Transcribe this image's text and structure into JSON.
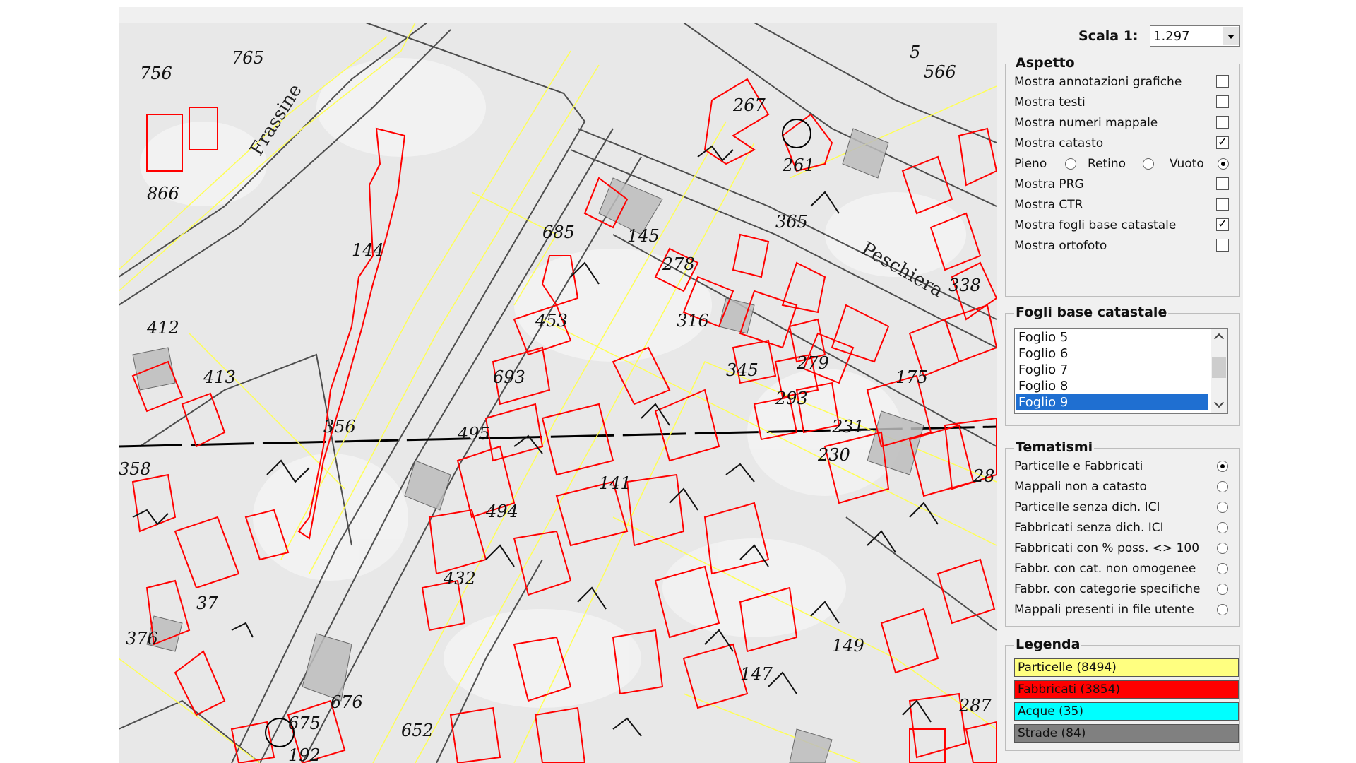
{
  "scale": {
    "label": "Scala 1:",
    "value": "1.297"
  },
  "aspetto": {
    "title": "Aspetto",
    "items": [
      {
        "label": "Mostra annotazioni grafiche",
        "checked": false
      },
      {
        "label": "Mostra testi",
        "checked": false
      },
      {
        "label": "Mostra numeri mappale",
        "checked": false
      },
      {
        "label": "Mostra catasto",
        "checked": true
      }
    ],
    "fill_mode": {
      "options": [
        {
          "label": "Pieno",
          "selected": false
        },
        {
          "label": "Retino",
          "selected": false
        },
        {
          "label": "Vuoto",
          "selected": true
        }
      ]
    },
    "items2": [
      {
        "label": "Mostra PRG",
        "checked": false
      },
      {
        "label": "Mostra CTR",
        "checked": false
      },
      {
        "label": "Mostra fogli base catastale",
        "checked": true
      },
      {
        "label": "Mostra ortofoto",
        "checked": false
      }
    ]
  },
  "fogli": {
    "title": "Fogli base catastale",
    "items": [
      "Foglio 5",
      "Foglio 6",
      "Foglio 7",
      "Foglio 8",
      "Foglio 9"
    ],
    "selected": "Foglio 9"
  },
  "tematismi": {
    "title": "Tematismi",
    "items": [
      {
        "label": "Particelle e Fabbricati",
        "selected": true
      },
      {
        "label": "Mappali non a catasto",
        "selected": false
      },
      {
        "label": "Particelle senza dich. ICI",
        "selected": false
      },
      {
        "label": "Fabbricati senza dich. ICI",
        "selected": false
      },
      {
        "label": "Fabbricati con % poss. <> 100",
        "selected": false
      },
      {
        "label": "Fabbr. con cat. non omogenee",
        "selected": false
      },
      {
        "label": "Fabbr. con categorie specifiche",
        "selected": false
      },
      {
        "label": "Mappali presenti in file utente",
        "selected": false
      }
    ]
  },
  "legenda": {
    "title": "Legenda",
    "items": [
      {
        "label": "Particelle (8494)",
        "color": "#ffff80"
      },
      {
        "label": "Fabbricati (3854)",
        "color": "#ff0000"
      },
      {
        "label": "Acque (35)",
        "color": "#00ffff"
      },
      {
        "label": "Strade (84)",
        "color": "#808080"
      }
    ]
  },
  "map": {
    "street_labels": [
      "Frassine",
      "Peschiera"
    ],
    "parcel_numbers": [
      "765",
      "756",
      "866",
      "144",
      "412",
      "413",
      "358",
      "37",
      "376",
      "267",
      "261",
      "566",
      "5",
      "365",
      "278",
      "685",
      "145",
      "453",
      "693",
      "495",
      "494",
      "141",
      "432",
      "675",
      "676",
      "652",
      "316",
      "345",
      "279",
      "293",
      "230",
      "231",
      "175",
      "28",
      "287",
      "149",
      "147",
      "338",
      "356",
      "192"
    ],
    "colors": {
      "parcel_outline": "#ffff66",
      "building_outline": "#ff0000",
      "base_sheet": "#2a2a2a",
      "background": "#e9e9e9"
    }
  }
}
